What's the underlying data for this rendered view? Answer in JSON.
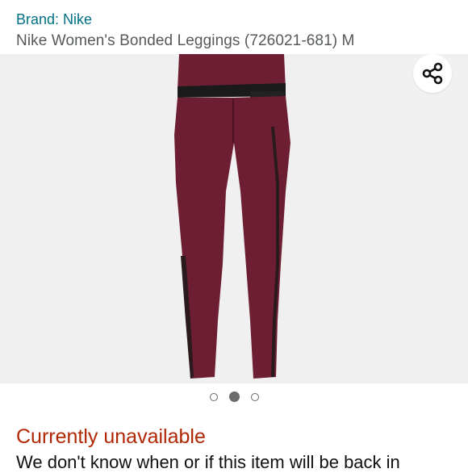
{
  "product": {
    "brand_label": "Brand: Nike",
    "title": "Nike Women's Bonded Leggings (726021-681) M"
  },
  "gallery": {
    "image_alt": "burgundy leggings back view",
    "image_count": 3,
    "active_index": 1,
    "share_icon": "share-icon",
    "colors": {
      "leggings": "#6e1e33",
      "band": "#1a1a1a"
    }
  },
  "availability": {
    "status": "Currently unavailable",
    "note": "We don't know when or if this item will be back in",
    "status_color": "#b12704"
  },
  "colors": {
    "link": "#007185",
    "title": "#565959"
  }
}
